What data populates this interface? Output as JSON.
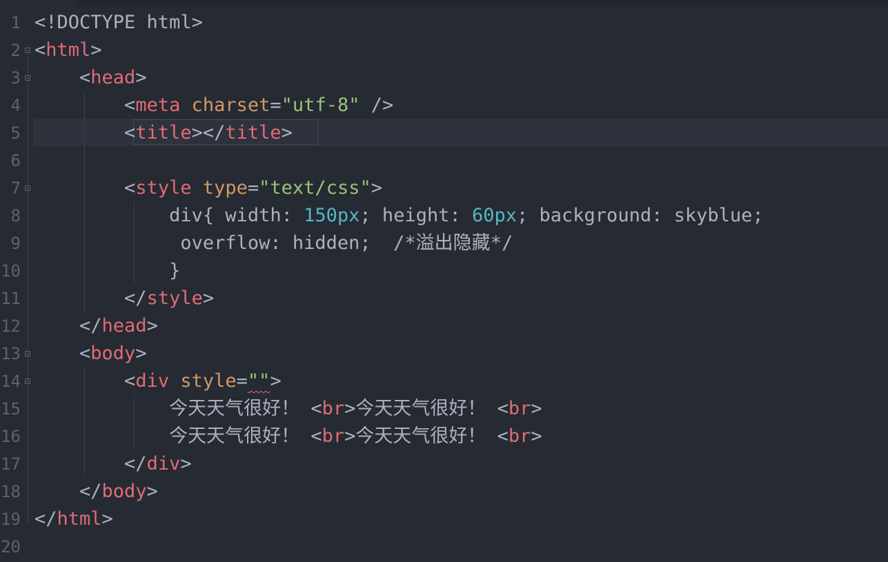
{
  "editor": {
    "line_numbers": [
      "1",
      "2",
      "3",
      "4",
      "5",
      "6",
      "7",
      "8",
      "9",
      "10",
      "11",
      "12",
      "13",
      "14",
      "15",
      "16",
      "17",
      "18",
      "19",
      "20"
    ],
    "lines": {
      "l1": [
        "<!DOCTYPE html>"
      ],
      "l2": [
        "<",
        "html",
        ">"
      ],
      "l3": [
        "    <",
        "head",
        ">"
      ],
      "l4": [
        "        <",
        "meta",
        " ",
        "charset",
        "=",
        "\"utf-8\"",
        " />"
      ],
      "l5": [
        "        <",
        "title",
        "></",
        "title",
        ">"
      ],
      "l7": [
        "        <",
        "style",
        " ",
        "type",
        "=",
        "\"text/css\"",
        ">"
      ],
      "l8": [
        "            div{ width: ",
        "150px",
        "; height: ",
        "60px",
        "; background: skyblue;"
      ],
      "l9": [
        "             overflow: hidden;  ",
        "/*溢出隐藏*/"
      ],
      "l10": [
        "            }"
      ],
      "l11": [
        "        </",
        "style",
        ">"
      ],
      "l12": [
        "    </",
        "head",
        ">"
      ],
      "l13": [
        "    <",
        "body",
        ">"
      ],
      "l14": [
        "        <",
        "div",
        " ",
        "style",
        "=",
        "\"\"",
        ">"
      ],
      "l15": [
        "            今天天气很好！ <",
        "br",
        ">今天天气很好！ <",
        "br",
        ">"
      ],
      "l16": [
        "            今天天气很好！ <",
        "br",
        ">今天天气很好！ <",
        "br",
        ">"
      ],
      "l17": [
        "        </",
        "div",
        ">"
      ],
      "l18": [
        "    </",
        "body",
        ">"
      ],
      "l19": [
        "</",
        "html",
        ">"
      ]
    }
  },
  "colors": {
    "background": "#262a33",
    "tag": "#e06c75",
    "attribute": "#d19a66",
    "string": "#98c379",
    "number": "#56b6c2",
    "plain": "#abb2bf",
    "gutter_text": "#5c6370"
  }
}
